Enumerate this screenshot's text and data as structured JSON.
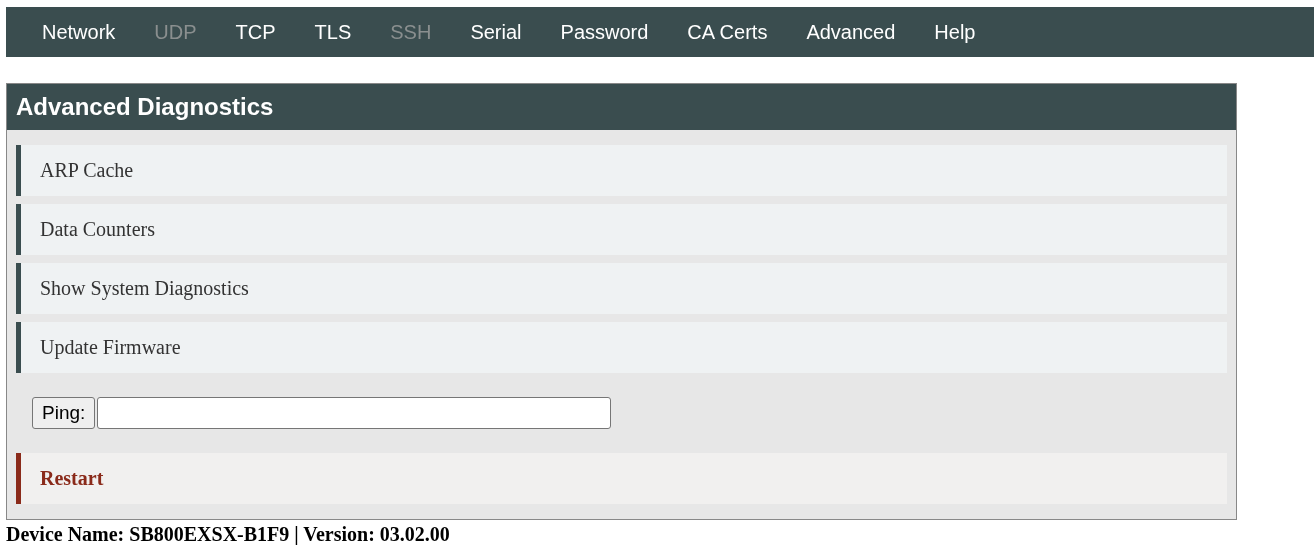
{
  "nav": [
    {
      "label": "Network",
      "disabled": false
    },
    {
      "label": "UDP",
      "disabled": true
    },
    {
      "label": "TCP",
      "disabled": false
    },
    {
      "label": "TLS",
      "disabled": false
    },
    {
      "label": "SSH",
      "disabled": true
    },
    {
      "label": "Serial",
      "disabled": false
    },
    {
      "label": "Password",
      "disabled": false
    },
    {
      "label": "CA Certs",
      "disabled": false
    },
    {
      "label": "Advanced",
      "disabled": false
    },
    {
      "label": "Help",
      "disabled": false
    }
  ],
  "panel": {
    "title": "Advanced Diagnostics",
    "items": [
      {
        "kind": "link",
        "label": "ARP Cache"
      },
      {
        "kind": "link",
        "label": "Data Counters"
      },
      {
        "kind": "link",
        "label": "Show System Diagnostics"
      },
      {
        "kind": "link",
        "label": "Update Firmware"
      },
      {
        "kind": "ping",
        "button": "Ping:"
      },
      {
        "kind": "danger",
        "label": "Restart"
      }
    ]
  },
  "footer": "Device Name: SB800EXSX-B1F9 | Version: 03.02.00"
}
